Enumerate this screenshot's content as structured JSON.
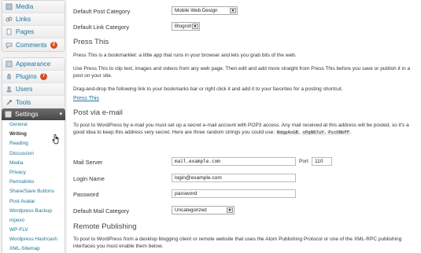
{
  "sidebar": {
    "top_items": [
      {
        "label": "Media",
        "icon": "media-icon"
      },
      {
        "label": "Links",
        "icon": "links-icon"
      },
      {
        "label": "Pages",
        "icon": "pages-icon"
      },
      {
        "label": "Comments",
        "icon": "comments-icon",
        "badge": "2"
      }
    ],
    "mid_items": [
      {
        "label": "Appearance",
        "icon": "appearance-icon"
      },
      {
        "label": "Plugins",
        "icon": "plugins-icon",
        "badge": "7"
      },
      {
        "label": "Users",
        "icon": "users-icon"
      },
      {
        "label": "Tools",
        "icon": "tools-icon"
      }
    ],
    "settings_label": "Settings",
    "settings_sub": [
      "General",
      "Writing",
      "Reading",
      "Discussion",
      "Media",
      "Privacy",
      "Permalinks",
      "Share/Save Buttons",
      "Post Avatar",
      "Wordpress Backup",
      "mpexo",
      "WP-FLV",
      "Wordpress Hashcash",
      "XML-Sitemap"
    ]
  },
  "main": {
    "default_post_category_label": "Default Post Category",
    "default_post_category_value": "Mobile Web Design",
    "default_link_category_label": "Default Link Category",
    "default_link_category_value": "Blogroll",
    "press_this_title": "Press This",
    "press_this_p1": "Press This is a bookmarklet: a little app that runs in your browser and lets you grab bits of the web.",
    "press_this_p2": "Use Press This to clip text, images and videos from any web page. Then edit and add more straight from Press This before you save or publish it in a post on your site.",
    "press_this_p3": "Drag-and-drop the following link to your bookmarks bar or right click it and add it to your favorites for a posting shortcut.",
    "press_this_link": "Press This",
    "post_via_email_title": "Post via e-mail",
    "email_p1": "To post to WordPress by e-mail you must set up a secret e-mail account with POP3 access. Any mail received at this address will be posted, so it's a good idea to keep this address very secret. Here are three random strings you could use:",
    "random_strings": [
      "NdgpAsGB",
      "sPgN67uY",
      "PscONbFF"
    ],
    "mail_server_label": "Mail Server",
    "mail_server_value": "mail.example.com",
    "port_label": "Port",
    "port_value": "110",
    "login_name_label": "Login Name",
    "login_name_value": "login@example.com",
    "password_label": "Password",
    "password_value": "password",
    "default_mail_category_label": "Default Mail Category",
    "default_mail_category_value": "Uncategorized",
    "remote_publishing_title": "Remote Publishing",
    "remote_p1": "To post to WordPress from a desktop blogging client or remote website that uses the Atom Publishing Protocol or one of the XML-RPC publishing interfaces you must enable them below."
  },
  "colors": {
    "link": "#21759b",
    "badge": "#d54e21",
    "settings_head": "#464646"
  }
}
